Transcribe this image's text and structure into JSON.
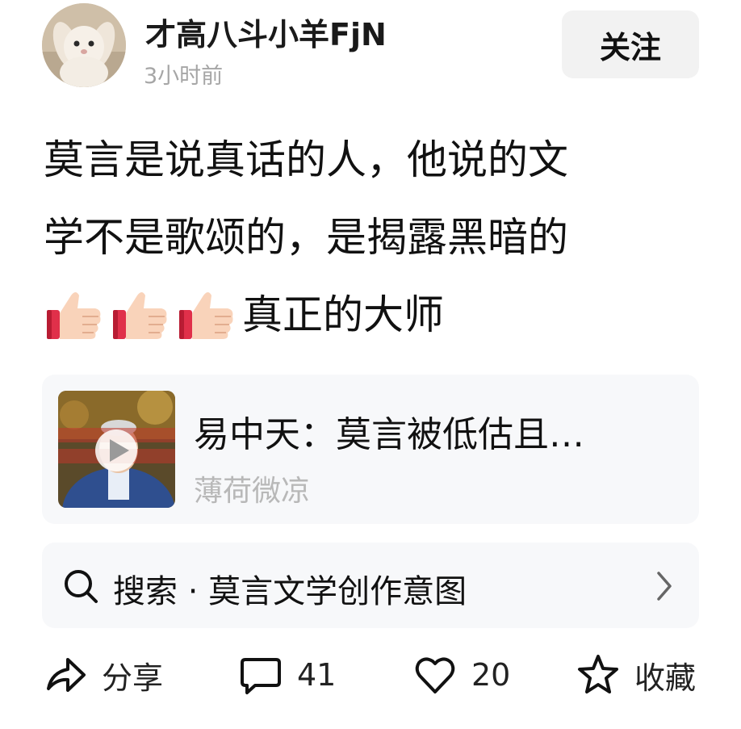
{
  "header": {
    "username": "才高八斗小羊FjN",
    "timestamp": "3小时前",
    "follow_label": "关注"
  },
  "post": {
    "line1": "莫言是说真话的人，他说的文",
    "line2": "学不是歌颂的，是揭露黑暗的",
    "line3_text": "真正的大师",
    "thumbs_count": 3
  },
  "linked_video": {
    "title": "易中天：莫言被低估且…",
    "source": "薄荷微凉"
  },
  "search": {
    "label": "搜索 · 莫言文学创作意图"
  },
  "actions": {
    "share": "分享",
    "comments": "41",
    "likes": "20",
    "favorite": "收藏"
  },
  "colors": {
    "follow_bg": "#f2f2f2",
    "card_bg": "#f7f8fa",
    "muted_text": "#a6a6a6"
  }
}
